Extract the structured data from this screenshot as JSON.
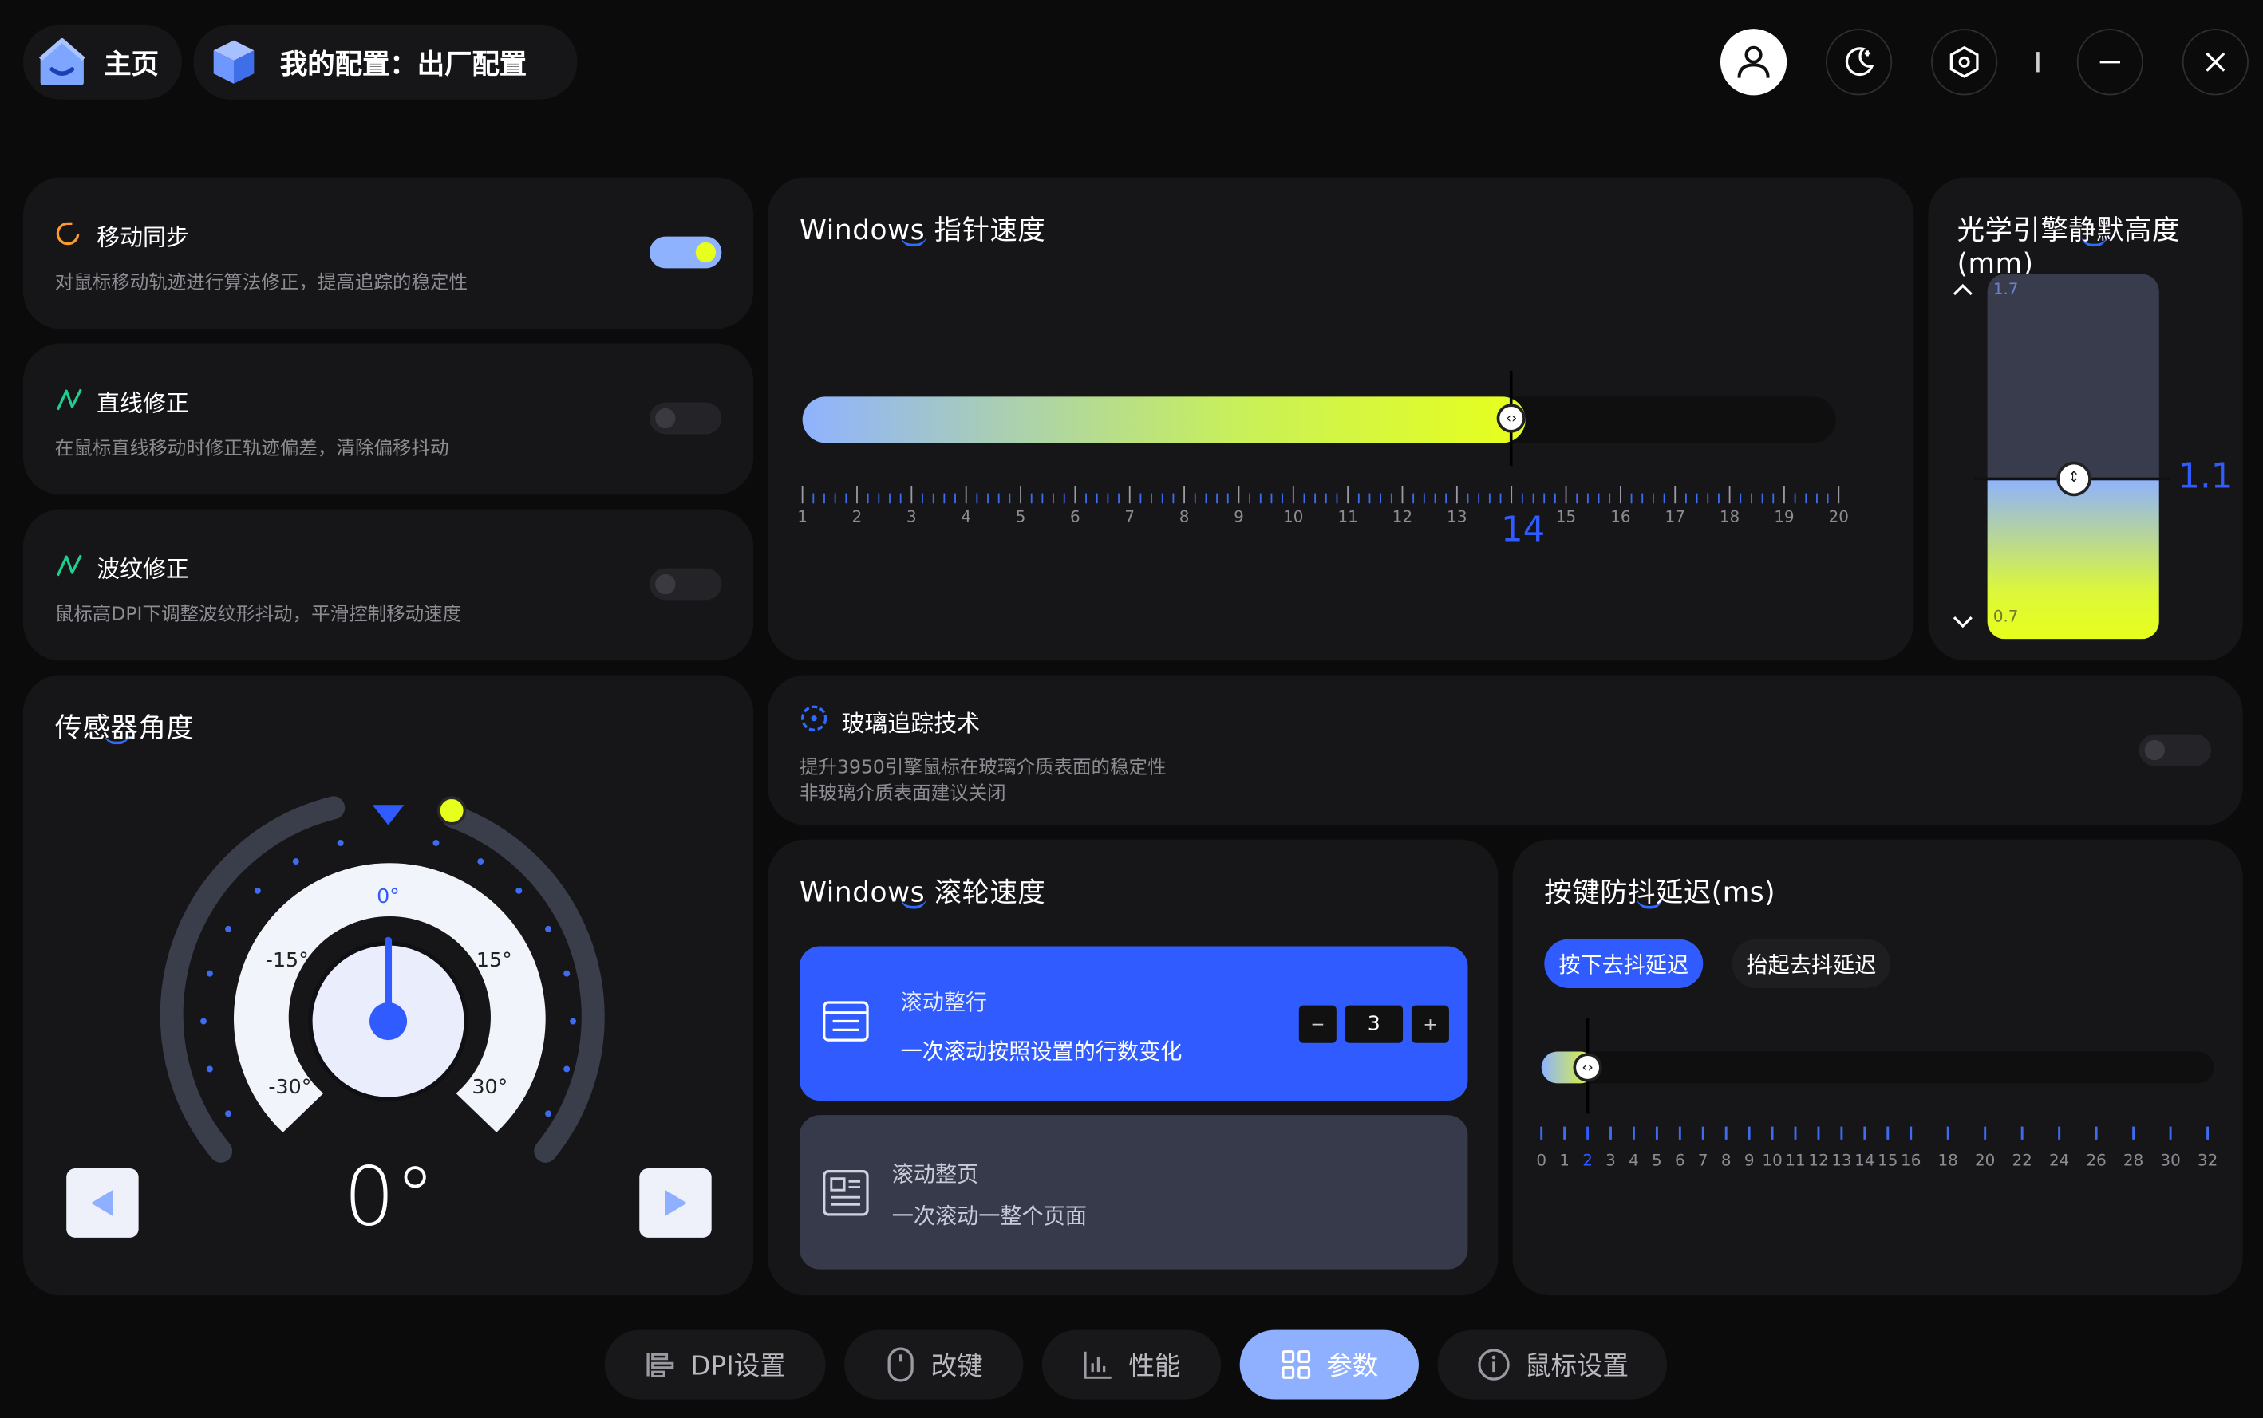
{
  "header": {
    "home_label": "主页",
    "config_label": "我的配置：出厂配置"
  },
  "icons": {
    "home": "home-icon",
    "cube": "cube-icon",
    "user": "user-icon",
    "theme": "moon-icon",
    "settings": "hexagon-gear-icon",
    "minimize": "minimize-icon",
    "close": "close-icon"
  },
  "motion_sync": {
    "title": "移动同步",
    "desc": "对鼠标移动轨迹进行算法修正，提高追踪的稳定性",
    "enabled": true
  },
  "angle_snap": {
    "title": "直线修正",
    "desc": "在鼠标直线移动时修正轨迹偏差，清除偏移抖动",
    "enabled": false
  },
  "ripple": {
    "title": "波纹修正",
    "desc": "鼠标高DPI下调整波纹形抖动，平滑控制移动速度",
    "enabled": false
  },
  "pointer_speed": {
    "title": "Windows 指针速度",
    "min": 1,
    "max": 20,
    "value": 14,
    "value_label": "14",
    "tick_labels": [
      "1",
      "2",
      "3",
      "4",
      "5",
      "6",
      "7",
      "8",
      "9",
      "10",
      "11",
      "12",
      "13",
      "",
      "15",
      "16",
      "17",
      "18",
      "19",
      "20"
    ]
  },
  "lod": {
    "title": "光学引擎静默高度(mm)",
    "max_label": "1.7",
    "min_label": "0.7",
    "value": 1.1,
    "value_label": "1.1"
  },
  "sensor_angle": {
    "title": "传感器角度",
    "value_label": "0°",
    "dial_labels": {
      "top": "0°",
      "left15": "-15°",
      "right15": "15°",
      "left30": "-30°",
      "right30": "30°"
    }
  },
  "glass_tracking": {
    "title": "玻璃追踪技术",
    "desc_line1": "提升3950引擎鼠标在玻璃介质表面的稳定性",
    "desc_line2": "非玻璃介质表面建议关闭",
    "enabled": false
  },
  "scroll_speed": {
    "title": "Windows 滚轮速度",
    "options": [
      {
        "title": "滚动整行",
        "desc": "一次滚动按照设置的行数变化",
        "selected": true
      },
      {
        "title": "滚动整页",
        "desc": "一次滚动一整个页面",
        "selected": false
      }
    ],
    "lines_value": "3",
    "minus_label": "−",
    "plus_label": "+"
  },
  "debounce": {
    "title": "按键防抖延迟(ms)",
    "tabs": [
      "按下去抖延迟",
      "抬起去抖延迟"
    ],
    "active_tab": 0,
    "value": 2,
    "tick_labels": [
      "0",
      "1",
      "2",
      "3",
      "4",
      "5",
      "6",
      "7",
      "8",
      "9",
      "10",
      "11",
      "12",
      "13",
      "14",
      "15",
      "16",
      "18",
      "20",
      "22",
      "24",
      "26",
      "28",
      "30",
      "32"
    ]
  },
  "bottom_tabs": [
    {
      "label": "DPI设置",
      "icon": "dpi-bars-icon",
      "active": false
    },
    {
      "label": "改键",
      "icon": "mouse-icon",
      "active": false
    },
    {
      "label": "性能",
      "icon": "chart-icon",
      "active": false
    },
    {
      "label": "参数",
      "icon": "grid-icon",
      "active": true
    },
    {
      "label": "鼠标设置",
      "icon": "info-icon",
      "active": false
    }
  ],
  "colors": {
    "accent_blue": "#2f5bff",
    "accent_yellow": "#e7ff1c",
    "panel": "#161618",
    "background": "#0b0b0c"
  }
}
